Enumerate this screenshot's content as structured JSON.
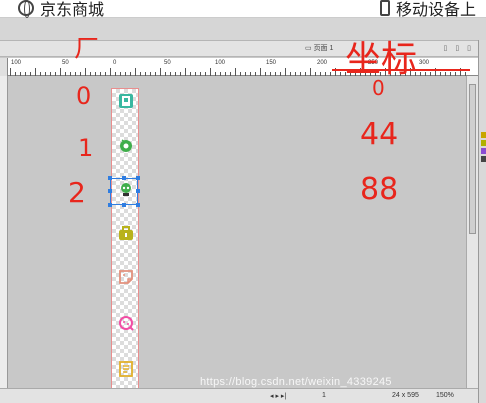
{
  "topbar": {
    "left_label": "京东商城",
    "right_label": "移动设备上",
    "left_icon": "globe-icon",
    "right_icon": "phone-icon"
  },
  "tabbar": {
    "page_tab": "页面 1",
    "icons": "▯ ▯ ▯"
  },
  "ruler": {
    "labels": [
      "100",
      "50",
      "0",
      "50",
      "100",
      "150",
      "200",
      "250",
      "300"
    ]
  },
  "annotations": {
    "top_left_mark": "ㄏ",
    "zero": "0",
    "one": "1",
    "two": "2",
    "title": "坐标",
    "value_0": "0",
    "value_44": "44",
    "value_88": "88"
  },
  "sprite_icons": [
    {
      "name": "qr-icon",
      "color": "#39b7a0"
    },
    {
      "name": "mobile-dot-icon",
      "color": "#3fae4b"
    },
    {
      "name": "robot-icon",
      "color": "#3fae4b"
    },
    {
      "name": "bag-icon",
      "color": "#b8b21c"
    },
    {
      "name": "note-icon",
      "color": "#e3907c"
    },
    {
      "name": "cookie-icon",
      "color": "#f24ea5"
    },
    {
      "name": "doc-icon",
      "color": "#e2b02b"
    }
  ],
  "statusbar": {
    "page_num": "1",
    "size": "24 x 595",
    "zoom": "150%",
    "nav": "◂ ▸ ▸|"
  },
  "watermark": "https://blog.csdn.net/weixin_4339245",
  "colors": {
    "annotation": "#e8261c",
    "selection": "#2f7de1",
    "sprite_border": "#e98e8e"
  }
}
